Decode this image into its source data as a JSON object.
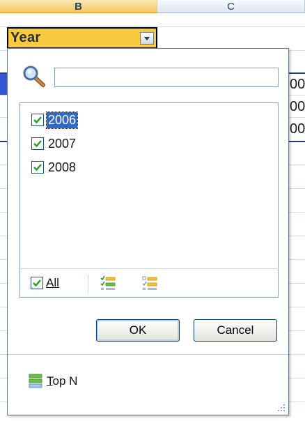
{
  "sheet": {
    "columns": [
      {
        "id": "B",
        "label": "B"
      },
      {
        "id": "C",
        "label": "C"
      }
    ],
    "header_cell": {
      "value": "Year"
    },
    "clipped_cells": [
      "00",
      "00",
      "00"
    ]
  },
  "filter": {
    "search": {
      "value": "",
      "placeholder": ""
    },
    "items": [
      {
        "label": "2006",
        "checked": true,
        "selected": true
      },
      {
        "label": "2007",
        "checked": true,
        "selected": false
      },
      {
        "label": "2008",
        "checked": true,
        "selected": false
      }
    ],
    "all": {
      "label": "All",
      "checked": true
    },
    "buttons": {
      "ok": "OK",
      "cancel": "Cancel"
    },
    "top_n": {
      "underline": "T",
      "rest": "op N"
    },
    "icons": [
      "search-icon",
      "select-all-checked-icon",
      "select-all-unchecked-icon",
      "top-n-icon"
    ]
  },
  "colors": {
    "header_cell": "#f7ca3f",
    "accent": "#316ac5",
    "check": "#1e9e1e"
  }
}
